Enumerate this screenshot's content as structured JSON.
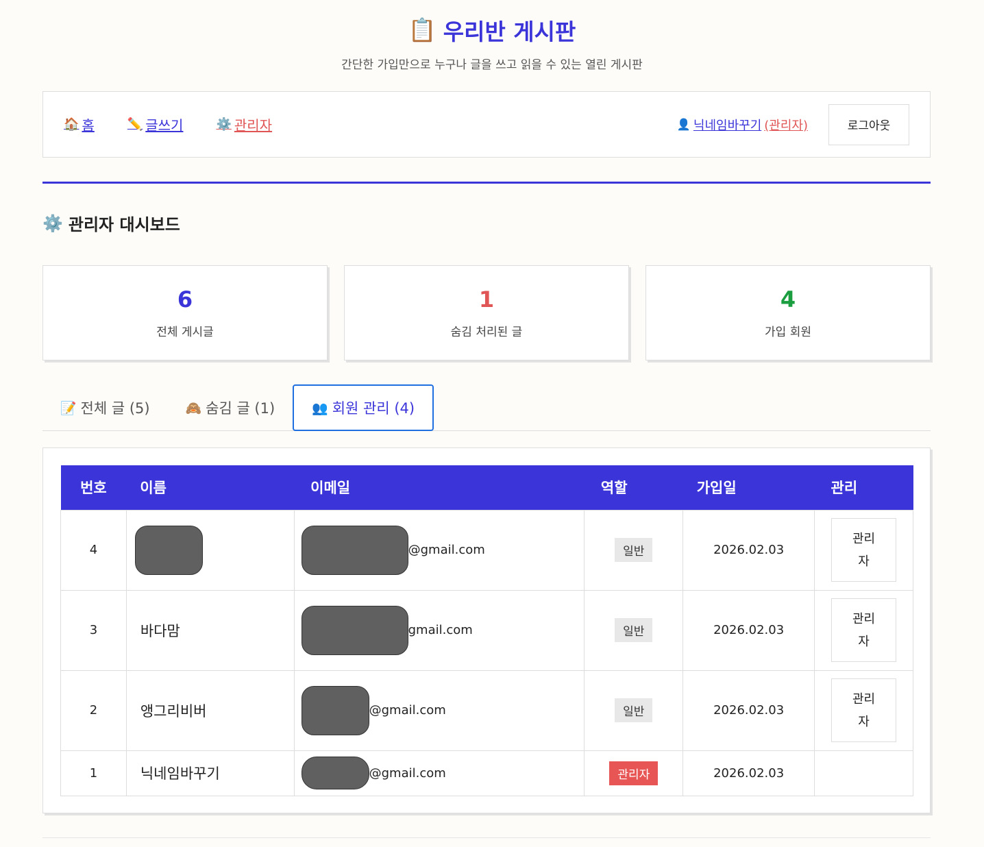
{
  "header": {
    "title_icon": "📋",
    "title": "우리반 게시판",
    "subtitle": "간단한 가입만으로 누구나 글을 쓰고 읽을 수 있는 열린 게시판"
  },
  "nav": {
    "links": [
      {
        "icon": "🏠",
        "label": "홈"
      },
      {
        "icon": "✏️",
        "label": "글쓰기"
      },
      {
        "icon": "⚙️",
        "label": "관리자"
      }
    ],
    "user_icon": "👤",
    "user_name": "닉네임바꾸기",
    "user_role": "(관리자)",
    "logout_label": "로그아웃"
  },
  "dashboard": {
    "icon": "⚙️",
    "title": "관리자 대시보드"
  },
  "stats": [
    {
      "value": "6",
      "label": "전체 게시글",
      "color": "#3b35d9"
    },
    {
      "value": "1",
      "label": "숨김 처리된 글",
      "color": "#e05555"
    },
    {
      "value": "4",
      "label": "가입 회원",
      "color": "#1a9e3f"
    }
  ],
  "tabs": [
    {
      "icon": "📝",
      "label": "전체 글 (5)"
    },
    {
      "icon": "🙈",
      "label": "숨김 글 (1)"
    },
    {
      "icon": "👥",
      "label": "회원 관리 (4)",
      "active": true
    }
  ],
  "table": {
    "headers": {
      "num": "번호",
      "name": "이름",
      "email": "이메일",
      "role": "역할",
      "joined": "가입일",
      "manage": "관리"
    },
    "rows": [
      {
        "num": "4",
        "name": "",
        "email_suffix": "@gmail.com",
        "role": "일반",
        "joined": "2026.02.03",
        "action": "관리자"
      },
      {
        "num": "3",
        "name": "바다맘",
        "email_suffix": "gmail.com",
        "role": "일반",
        "joined": "2026.02.03",
        "action": "관리자"
      },
      {
        "num": "2",
        "name": "앵그리비버",
        "email_suffix": "@gmail.com",
        "role": "일반",
        "joined": "2026.02.03",
        "action": "관리자"
      },
      {
        "num": "1",
        "name": "닉네임바꾸기",
        "email_suffix": "@gmail.com",
        "role": "관리자",
        "joined": "2026.02.03",
        "action": ""
      }
    ]
  },
  "colors": {
    "accent": "#3b35d9",
    "danger": "#e05555",
    "success": "#1a9e3f",
    "tab_border": "#1f6fe0"
  }
}
